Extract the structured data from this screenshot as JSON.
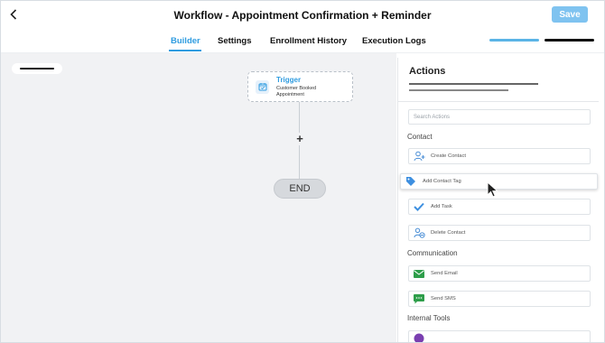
{
  "header": {
    "title": "Workflow - Appointment Confirmation + Reminder",
    "save_label": "Save"
  },
  "tabs": [
    {
      "label": "Builder",
      "active": true
    },
    {
      "label": "Settings",
      "active": false
    },
    {
      "label": "Enrollment History",
      "active": false
    },
    {
      "label": "Execution Logs",
      "active": false
    }
  ],
  "canvas": {
    "trigger": {
      "title": "Trigger",
      "subtitle": "Customer Booked Appointment"
    },
    "add_symbol": "+",
    "end_label": "END"
  },
  "panel": {
    "title": "Actions",
    "search_placeholder": "Search Actions",
    "sections": [
      {
        "title": "Contact",
        "items": [
          {
            "label": "Create Contact",
            "icon": "create-contact-icon"
          },
          {
            "label": "Add Contact Tag",
            "icon": "tag-icon"
          },
          {
            "label": "Add Task",
            "icon": "checkmark-icon"
          },
          {
            "label": "Delete Contact",
            "icon": "delete-contact-icon"
          }
        ]
      },
      {
        "title": "Communication",
        "items": [
          {
            "label": "Send Email",
            "icon": "email-icon"
          },
          {
            "label": "Send SMS",
            "icon": "sms-icon"
          }
        ]
      },
      {
        "title": "Internal Tools",
        "items": []
      }
    ]
  },
  "colors": {
    "accent": "#2f9ce0",
    "save_button": "#7fc3f0",
    "canvas_bg": "#f1f2f4",
    "email_green": "#2e9e4a"
  }
}
